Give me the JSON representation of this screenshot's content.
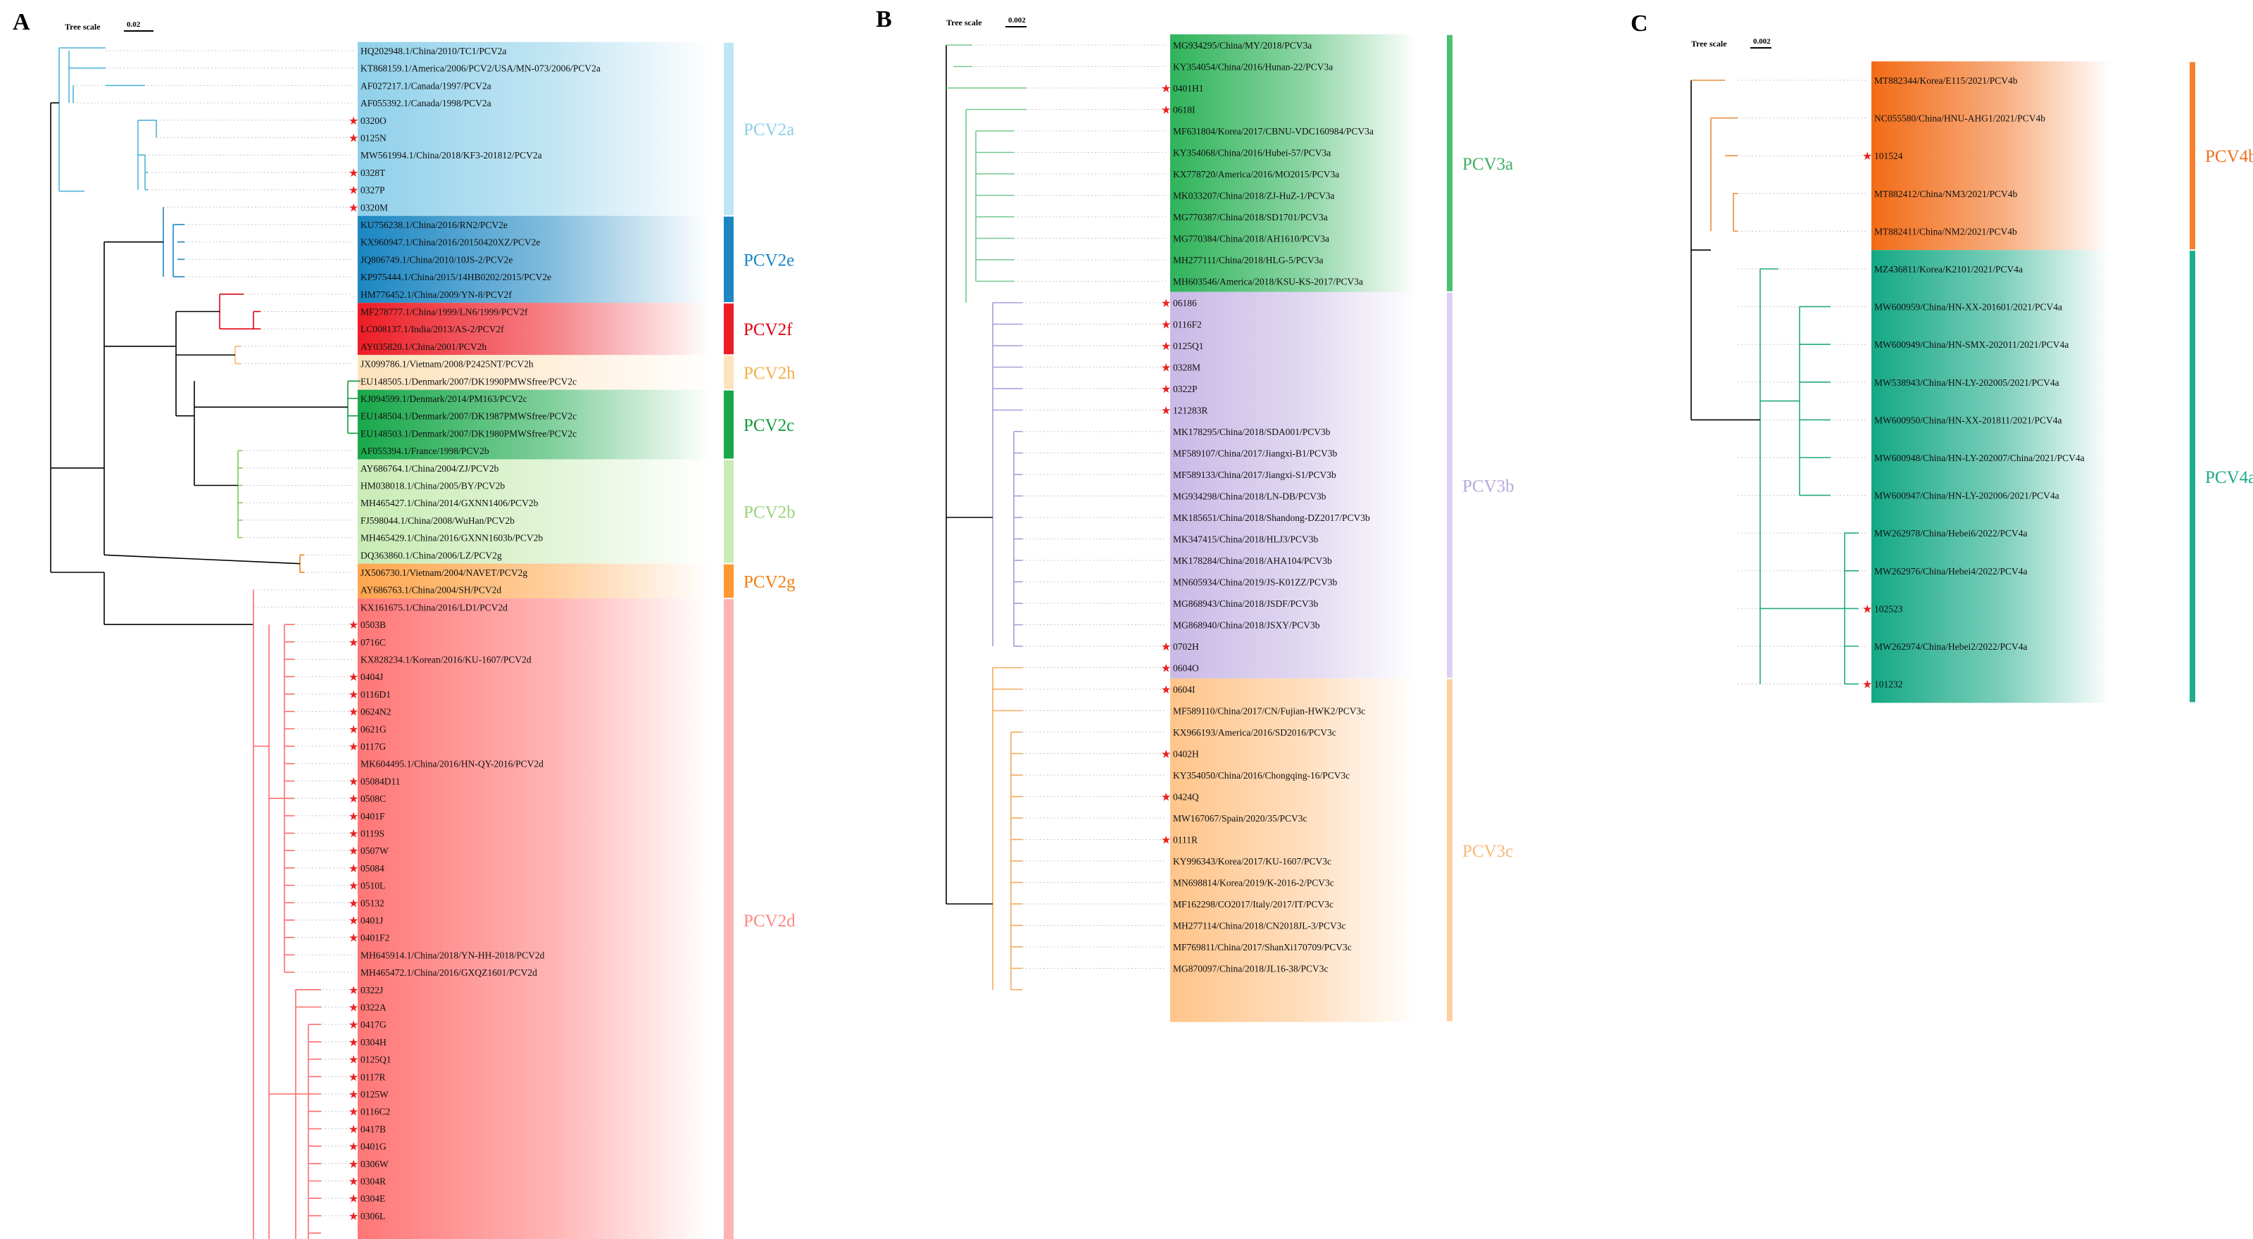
{
  "panels": [
    {
      "letter": "A",
      "scale_title": "Tree scale",
      "scale_value": "0.02",
      "star_color": "#e8211f",
      "clades": [
        {
          "name": "PCV2a",
          "color": "#8fd0ea",
          "bar": "#bfe6f4",
          "line": "#4fb3d9",
          "text": "#8fcfe6",
          "count": 10
        },
        {
          "name": "PCV2e",
          "color": "#1b86c2",
          "bar": "#1b86c2",
          "line": "#1b86c2",
          "text": "#1b86c2",
          "count": 5
        },
        {
          "name": "PCV2f",
          "color": "#ee1c25",
          "bar": "#ee1c25",
          "line": "#e00010",
          "text": "#e00010",
          "count": 3
        },
        {
          "name": "PCV2h",
          "color": "#fde3bd",
          "bar": "#fde3bd",
          "line": "#f6b86c",
          "text": "#f4b04c",
          "count": 2
        },
        {
          "name": "PCV2c",
          "color": "#18a84a",
          "bar": "#18a84a",
          "line": "#139a3e",
          "text": "#139a3e",
          "count": 4
        },
        {
          "name": "PCV2b",
          "color": "#c9ecb5",
          "bar": "#c9ecb5",
          "line": "#7acb55",
          "text": "#9bd47c",
          "count": 6
        },
        {
          "name": "PCV2g",
          "color": "#ffa64d",
          "bar": "#ff9830",
          "line": "#f07e12",
          "text": "#f07e12",
          "count": 2
        },
        {
          "name": "PCV2d",
          "color": "#ff7676",
          "bar": "#ffb3b3",
          "line": "#ff6b6b",
          "text": "#ff8686",
          "count": 37
        }
      ],
      "leaves": [
        {
          "label": "HQ202948.1/China/2010/TC1/PCV2a",
          "star": false
        },
        {
          "label": "KT868159.1/America/2006/PCV2/USA/MN-073/2006/PCV2a",
          "star": false
        },
        {
          "label": "AF027217.1/Canada/1997/PCV2a",
          "star": false
        },
        {
          "label": "AF055392.1/Canada/1998/PCV2a",
          "star": false
        },
        {
          "label": "0320O",
          "star": true
        },
        {
          "label": "0125N",
          "star": true
        },
        {
          "label": "MW561994.1/China/2018/KF3-201812/PCV2a",
          "star": false
        },
        {
          "label": "0328T",
          "star": true
        },
        {
          "label": "0327P",
          "star": true
        },
        {
          "label": "0320M",
          "star": true
        },
        {
          "label": "KU756238.1/China/2016/RN2/PCV2e",
          "star": false
        },
        {
          "label": "KX960947.1/China/2016/20150420XZ/PCV2e",
          "star": false
        },
        {
          "label": "JQ806749.1/China/2010/10JS-2/PCV2e",
          "star": false
        },
        {
          "label": "KP975444.1/China/2015/14HB0202/2015/PCV2e",
          "star": false
        },
        {
          "label": "HM776452.1/China/2009/YN-8/PCV2f",
          "star": false
        },
        {
          "label": "MF278777.1/China/1999/LN6/1999/PCV2f",
          "star": false
        },
        {
          "label": "LC008137.1/India/2013/AS-2/PCV2f",
          "star": false
        },
        {
          "label": "AY035820.1/China/2001/PCV2h",
          "star": false
        },
        {
          "label": "JX099786.1/Vietnam/2008/P2425NT/PCV2h",
          "star": false
        },
        {
          "label": "EU148505.1/Denmark/2007/DK1990PMWSfree/PCV2c",
          "star": false
        },
        {
          "label": "KJ094599.1/Denmark/2014/PM163/PCV2c",
          "star": false
        },
        {
          "label": "EU148504.1/Denmark/2007/DK1987PMWSfree/PCV2c",
          "star": false
        },
        {
          "label": "EU148503.1/Denmark/2007/DK1980PMWSfree/PCV2c",
          "star": false
        },
        {
          "label": "AF055394.1/France/1998/PCV2b",
          "star": false
        },
        {
          "label": "AY686764.1/China/2004/ZJ/PCV2b",
          "star": false
        },
        {
          "label": "HM038018.1/China/2005/BY/PCV2b",
          "star": false
        },
        {
          "label": "MH465427.1/China/2014/GXNN1406/PCV2b",
          "star": false
        },
        {
          "label": "FJ598044.1/China/2008/WuHan/PCV2b",
          "star": false
        },
        {
          "label": "MH465429.1/China/2016/GXNN1603b/PCV2b",
          "star": false
        },
        {
          "label": "DQ363860.1/China/2006/LZ/PCV2g",
          "star": false
        },
        {
          "label": "JX506730.1/Vietnam/2004/NAVET/PCV2g",
          "star": false
        },
        {
          "label": "AY686763.1/China/2004/SH/PCV2d",
          "star": false
        },
        {
          "label": "KX161675.1/China/2016/LD1/PCV2d",
          "star": false
        },
        {
          "label": "0503B",
          "star": true
        },
        {
          "label": "0716C",
          "star": true
        },
        {
          "label": "KX828234.1/Korean/2016/KU-1607/PCV2d",
          "star": false
        },
        {
          "label": "0404J",
          "star": true
        },
        {
          "label": "0116D1",
          "star": true
        },
        {
          "label": "0624N2",
          "star": true
        },
        {
          "label": "0621G",
          "star": true
        },
        {
          "label": "0117G",
          "star": true
        },
        {
          "label": "MK604495.1/China/2016/HN-QY-2016/PCV2d",
          "star": false
        },
        {
          "label": "05084D11",
          "star": true
        },
        {
          "label": "0508C",
          "star": true
        },
        {
          "label": "0401F",
          "star": true
        },
        {
          "label": "0119S",
          "star": true
        },
        {
          "label": "0507W",
          "star": true
        },
        {
          "label": "05084",
          "star": true
        },
        {
          "label": "0510L",
          "star": true
        },
        {
          "label": "05132",
          "star": true
        },
        {
          "label": "0401J",
          "star": true
        },
        {
          "label": "0401F2",
          "star": true
        },
        {
          "label": "MH645914.1/China/2018/YN-HH-2018/PCV2d",
          "star": false
        },
        {
          "label": "MH465472.1/China/2016/GXQZ1601/PCV2d",
          "star": false
        },
        {
          "label": "0322J",
          "star": true
        },
        {
          "label": "0322A",
          "star": true
        },
        {
          "label": "0417G",
          "star": true
        },
        {
          "label": "0304H",
          "star": true
        },
        {
          "label": "0125Q1",
          "star": true
        },
        {
          "label": "0117R",
          "star": true
        },
        {
          "label": "0125W",
          "star": true
        },
        {
          "label": "0116C2",
          "star": true
        },
        {
          "label": "0417B",
          "star": true
        },
        {
          "label": "0401G",
          "star": true
        },
        {
          "label": "0306W",
          "star": true
        },
        {
          "label": "0304R",
          "star": true
        },
        {
          "label": "0304E",
          "star": true
        },
        {
          "label": "0306L",
          "star": true
        }
      ]
    },
    {
      "letter": "B",
      "scale_title": "Tree scale",
      "scale_value": "0.002",
      "star_color": "#e8211f",
      "clades": [
        {
          "name": "PCV3a",
          "color": "#2fb35a",
          "bar": "#4cc06f",
          "line": "#72c98a",
          "text": "#3fae62",
          "count": 12
        },
        {
          "name": "PCV3b",
          "color": "#c9b9e6",
          "bar": "#ddd0f2",
          "line": "#a99ad8",
          "text": "#b8a8de",
          "count": 18
        },
        {
          "name": "PCV3c",
          "color": "#ffc48a",
          "bar": "#ffcf9e",
          "line": "#f5a95c",
          "text": "#f8b878",
          "count": 16
        }
      ],
      "leaves": [
        {
          "label": "MG934295/China/MY/2018/PCV3a",
          "star": false
        },
        {
          "label": "KY354054/China/2016/Hunan-22/PCV3a",
          "star": false
        },
        {
          "label": "0401H1",
          "star": true
        },
        {
          "label": "0618I",
          "star": true
        },
        {
          "label": "MF631804/Korea/2017/CBNU-VDC160984/PCV3a",
          "star": false
        },
        {
          "label": "KY354068/China/2016/Hubei-57/PCV3a",
          "star": false
        },
        {
          "label": "KX778720/America/2016/MO2015/PCV3a",
          "star": false
        },
        {
          "label": "MK033207/China/2018/ZJ-HuZ-1/PCV3a",
          "star": false
        },
        {
          "label": "MG770387/China/2018/SD1701/PCV3a",
          "star": false
        },
        {
          "label": "MG770384/China/2018/AH1610/PCV3a",
          "star": false
        },
        {
          "label": "MH277111/China/2018/HLG-5/PCV3a",
          "star": false
        },
        {
          "label": "MH603546/America/2018/KSU-KS-2017/PCV3a",
          "star": false
        },
        {
          "label": "06186",
          "star": true
        },
        {
          "label": "0116F2",
          "star": true
        },
        {
          "label": "0125Q1",
          "star": true
        },
        {
          "label": "0328M",
          "star": true
        },
        {
          "label": "0322P",
          "star": true
        },
        {
          "label": "121283R",
          "star": true
        },
        {
          "label": "MK178295/China/2018/SDA001/PCV3b",
          "star": false
        },
        {
          "label": "MF589107/China/2017/Jiangxi-B1/PCV3b",
          "star": false
        },
        {
          "label": "MF589133/China/2017/Jiangxi-S1/PCV3b",
          "star": false
        },
        {
          "label": "MG934298/China/2018/LN-DB/PCV3b",
          "star": false
        },
        {
          "label": "MK185651/China/2018/Shandong-DZ2017/PCV3b",
          "star": false
        },
        {
          "label": "MK347415/China/2018/HLJ3/PCV3b",
          "star": false
        },
        {
          "label": "MK178284/China/2018/AHA104/PCV3b",
          "star": false
        },
        {
          "label": "MN605934/China/2019/JS-K01ZZ/PCV3b",
          "star": false
        },
        {
          "label": "MG868943/China/2018/JSDF/PCV3b",
          "star": false
        },
        {
          "label": "MG868940/China/2018/JSXY/PCV3b",
          "star": false
        },
        {
          "label": "0702H",
          "star": true
        },
        {
          "label": "0604O",
          "star": true
        },
        {
          "label": "0604I",
          "star": true
        },
        {
          "label": "MF589110/China/2017/CN/Fujian-HWK2/PCV3c",
          "star": false
        },
        {
          "label": "KX966193/America/2016/SD2016/PCV3c",
          "star": false
        },
        {
          "label": "0402H",
          "star": true
        },
        {
          "label": "KY354050/China/2016/Chongqing-16/PCV3c",
          "star": false
        },
        {
          "label": "0424Q",
          "star": true
        },
        {
          "label": "MW167067/Spain/2020/35/PCV3c",
          "star": false
        },
        {
          "label": "0111R",
          "star": true
        },
        {
          "label": "KY996343/Korea/2017/KU-1607/PCV3c",
          "star": false
        },
        {
          "label": "MN698814/Korea/2019/K-2016-2/PCV3c",
          "star": false
        },
        {
          "label": "MF162298/CO2017/Italy/2017/IT/PCV3c",
          "star": false
        },
        {
          "label": "MH277114/China/2018/CN2018JL-3/PCV3c",
          "star": false
        },
        {
          "label": "MF769811/China/2017/ShanXi170709/PCV3c",
          "star": false
        },
        {
          "label": "MG870097/China/2018/JL16-38/PCV3c",
          "star": false
        }
      ]
    },
    {
      "letter": "C",
      "scale_title": "Tree scale",
      "scale_value": "0.002",
      "star_color": "#e8211f",
      "clades": [
        {
          "name": "PCV4b",
          "color": "#f26b16",
          "bar": "#f7822e",
          "line": "#e98b3a",
          "text": "#f07020",
          "count": 5
        },
        {
          "name": "PCV4a",
          "color": "#14a884",
          "bar": "#1fae8c",
          "line": "#22a882",
          "text": "#1aa886",
          "count": 12
        }
      ],
      "leaves": [
        {
          "label": "MT882344/Korea/E115/2021/PCV4b",
          "star": false
        },
        {
          "label": "NC055580/China/HNU-AHG1/2021/PCV4b",
          "star": false
        },
        {
          "label": "101524",
          "star": true
        },
        {
          "label": "MT882412/China/NM3/2021/PCV4b",
          "star": false
        },
        {
          "label": "MT882411/China/NM2/2021/PCV4b",
          "star": false
        },
        {
          "label": "MZ436811/Korea/K2101/2021/PCV4a",
          "star": false
        },
        {
          "label": "MW600959/China/HN-XX-201601/2021/PCV4a",
          "star": false
        },
        {
          "label": "MW600949/China/HN-SMX-202011/2021/PCV4a",
          "star": false
        },
        {
          "label": "MW538943/China/HN-LY-202005/2021/PCV4a",
          "star": false
        },
        {
          "label": "MW600950/China/HN-XX-201811/2021/PCV4a",
          "star": false
        },
        {
          "label": "MW600948/China/HN-LY-202007/China/2021/PCV4a",
          "star": false
        },
        {
          "label": "MW600947/China/HN-LY-202006/2021/PCV4a",
          "star": false
        },
        {
          "label": "MW262978/China/Hebei6/2022/PCV4a",
          "star": false
        },
        {
          "label": "MW262976/China/Hebei4/2022/PCV4a",
          "star": false
        },
        {
          "label": "102523",
          "star": true
        },
        {
          "label": "MW262974/China/Hebei2/2022/PCV4a",
          "star": false
        },
        {
          "label": "101232",
          "star": true
        }
      ]
    }
  ]
}
